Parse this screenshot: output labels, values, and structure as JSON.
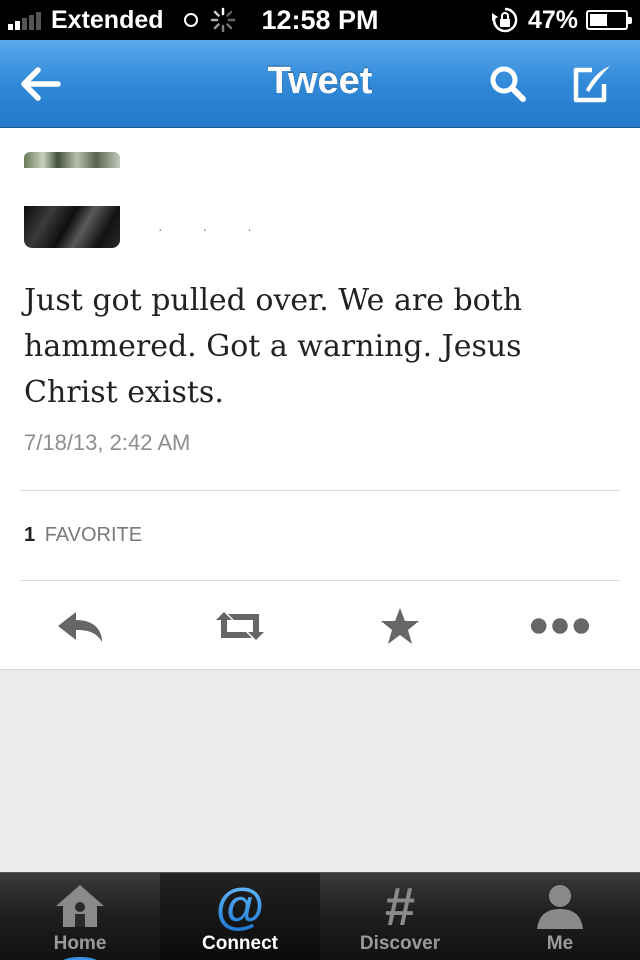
{
  "status_bar": {
    "carrier": "Extended",
    "time": "12:58 PM",
    "battery_percent": "47%",
    "battery_level": 0.47,
    "signal_bars": 2
  },
  "nav": {
    "title": "Tweet",
    "back_icon": "back-arrow-icon",
    "search_icon": "search-icon",
    "compose_icon": "compose-icon",
    "color": "#3189d8"
  },
  "tweet": {
    "text": "Just got pulled over. We are both hammered. Got a warning. Jesus Christ exists.",
    "timestamp": "7/18/13, 2:42 AM",
    "favorites": {
      "count": "1",
      "label": "FAVORITE"
    },
    "actions": [
      "reply-icon",
      "retweet-icon",
      "star-icon",
      "more-icon"
    ]
  },
  "tabbar": {
    "tabs": [
      {
        "label": "Home",
        "icon": "home-icon",
        "active": false
      },
      {
        "label": "Connect",
        "icon": "at-icon",
        "active": true
      },
      {
        "label": "Discover",
        "icon": "hash-icon",
        "active": false
      },
      {
        "label": "Me",
        "icon": "person-icon",
        "active": false
      }
    ],
    "accent": "#3a95e8"
  }
}
